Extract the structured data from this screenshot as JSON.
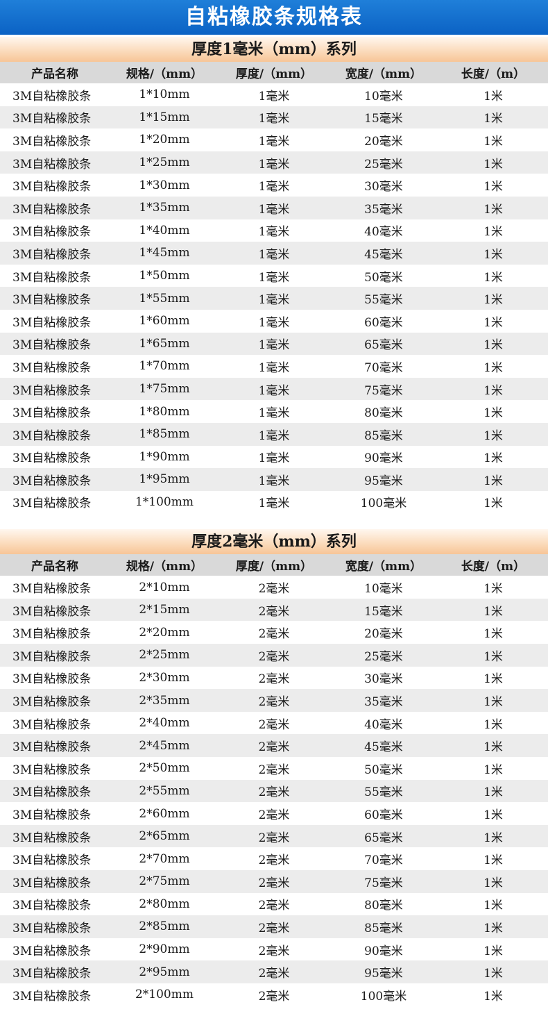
{
  "title": "自粘橡胶条规格表",
  "columns": [
    "产品名称",
    "规格/（mm）",
    "厚度/（mm）",
    "宽度/（mm）",
    "长度/（m）"
  ],
  "sections": [
    {
      "header": "厚度1毫米（mm）系列",
      "rows": [
        [
          "3M自粘橡胶条",
          "1*10mm",
          "1毫米",
          "10毫米",
          "1米"
        ],
        [
          "3M自粘橡胶条",
          "1*15mm",
          "1毫米",
          "15毫米",
          "1米"
        ],
        [
          "3M自粘橡胶条",
          "1*20mm",
          "1毫米",
          "20毫米",
          "1米"
        ],
        [
          "3M自粘橡胶条",
          "1*25mm",
          "1毫米",
          "25毫米",
          "1米"
        ],
        [
          "3M自粘橡胶条",
          "1*30mm",
          "1毫米",
          "30毫米",
          "1米"
        ],
        [
          "3M自粘橡胶条",
          "1*35mm",
          "1毫米",
          "35毫米",
          "1米"
        ],
        [
          "3M自粘橡胶条",
          "1*40mm",
          "1毫米",
          "40毫米",
          "1米"
        ],
        [
          "3M自粘橡胶条",
          "1*45mm",
          "1毫米",
          "45毫米",
          "1米"
        ],
        [
          "3M自粘橡胶条",
          "1*50mm",
          "1毫米",
          "50毫米",
          "1米"
        ],
        [
          "3M自粘橡胶条",
          "1*55mm",
          "1毫米",
          "55毫米",
          "1米"
        ],
        [
          "3M自粘橡胶条",
          "1*60mm",
          "1毫米",
          "60毫米",
          "1米"
        ],
        [
          "3M自粘橡胶条",
          "1*65mm",
          "1毫米",
          "65毫米",
          "1米"
        ],
        [
          "3M自粘橡胶条",
          "1*70mm",
          "1毫米",
          "70毫米",
          "1米"
        ],
        [
          "3M自粘橡胶条",
          "1*75mm",
          "1毫米",
          "75毫米",
          "1米"
        ],
        [
          "3M自粘橡胶条",
          "1*80mm",
          "1毫米",
          "80毫米",
          "1米"
        ],
        [
          "3M自粘橡胶条",
          "1*85mm",
          "1毫米",
          "85毫米",
          "1米"
        ],
        [
          "3M自粘橡胶条",
          "1*90mm",
          "1毫米",
          "90毫米",
          "1米"
        ],
        [
          "3M自粘橡胶条",
          "1*95mm",
          "1毫米",
          "95毫米",
          "1米"
        ],
        [
          "3M自粘橡胶条",
          "1*100mm",
          "1毫米",
          "100毫米",
          "1米"
        ]
      ]
    },
    {
      "header": "厚度2毫米（mm）系列",
      "rows": [
        [
          "3M自粘橡胶条",
          "2*10mm",
          "2毫米",
          "10毫米",
          "1米"
        ],
        [
          "3M自粘橡胶条",
          "2*15mm",
          "2毫米",
          "15毫米",
          "1米"
        ],
        [
          "3M自粘橡胶条",
          "2*20mm",
          "2毫米",
          "20毫米",
          "1米"
        ],
        [
          "3M自粘橡胶条",
          "2*25mm",
          "2毫米",
          "25毫米",
          "1米"
        ],
        [
          "3M自粘橡胶条",
          "2*30mm",
          "2毫米",
          "30毫米",
          "1米"
        ],
        [
          "3M自粘橡胶条",
          "2*35mm",
          "2毫米",
          "35毫米",
          "1米"
        ],
        [
          "3M自粘橡胶条",
          "2*40mm",
          "2毫米",
          "40毫米",
          "1米"
        ],
        [
          "3M自粘橡胶条",
          "2*45mm",
          "2毫米",
          "45毫米",
          "1米"
        ],
        [
          "3M自粘橡胶条",
          "2*50mm",
          "2毫米",
          "50毫米",
          "1米"
        ],
        [
          "3M自粘橡胶条",
          "2*55mm",
          "2毫米",
          "55毫米",
          "1米"
        ],
        [
          "3M自粘橡胶条",
          "2*60mm",
          "2毫米",
          "60毫米",
          "1米"
        ],
        [
          "3M自粘橡胶条",
          "2*65mm",
          "2毫米",
          "65毫米",
          "1米"
        ],
        [
          "3M自粘橡胶条",
          "2*70mm",
          "2毫米",
          "70毫米",
          "1米"
        ],
        [
          "3M自粘橡胶条",
          "2*75mm",
          "2毫米",
          "75毫米",
          "1米"
        ],
        [
          "3M自粘橡胶条",
          "2*80mm",
          "2毫米",
          "80毫米",
          "1米"
        ],
        [
          "3M自粘橡胶条",
          "2*85mm",
          "2毫米",
          "85毫米",
          "1米"
        ],
        [
          "3M自粘橡胶条",
          "2*90mm",
          "2毫米",
          "90毫米",
          "1米"
        ],
        [
          "3M自粘橡胶条",
          "2*95mm",
          "2毫米",
          "95毫米",
          "1米"
        ],
        [
          "3M自粘橡胶条",
          "2*100mm",
          "2毫米",
          "100毫米",
          "1米"
        ]
      ]
    }
  ]
}
